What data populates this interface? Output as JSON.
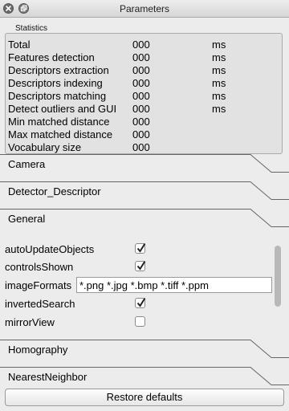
{
  "window": {
    "title": "Parameters"
  },
  "statistics": {
    "group_title": "Statistics",
    "rows": [
      {
        "name": "Total",
        "value": "000",
        "unit": "ms"
      },
      {
        "name": "Features detection",
        "value": "000",
        "unit": "ms"
      },
      {
        "name": "Descriptors extraction",
        "value": "000",
        "unit": "ms"
      },
      {
        "name": "Descriptors indexing",
        "value": "000",
        "unit": "ms"
      },
      {
        "name": "Descriptors matching",
        "value": "000",
        "unit": "ms"
      },
      {
        "name": "Detect outliers and GUI",
        "value": "000",
        "unit": "ms"
      },
      {
        "name": "Min matched distance",
        "value": "000",
        "unit": ""
      },
      {
        "name": "Max matched distance",
        "value": "000",
        "unit": ""
      },
      {
        "name": "Vocabulary size",
        "value": "000",
        "unit": ""
      }
    ]
  },
  "sections": {
    "camera": "Camera",
    "detector_descriptor": "Detector_Descriptor",
    "general": "General",
    "homography": "Homography",
    "nearest_neighbor": "NearestNeighbor"
  },
  "general": {
    "auto_update_objects": {
      "label": "autoUpdateObjects",
      "checked": true
    },
    "controls_shown": {
      "label": "controlsShown",
      "checked": true
    },
    "image_formats": {
      "label": "imageFormats",
      "value": "*.png *.jpg *.bmp *.tiff *.ppm"
    },
    "inverted_search": {
      "label": "invertedSearch",
      "checked": true
    },
    "mirror_view": {
      "label": "mirrorView",
      "checked": false
    }
  },
  "footer": {
    "restore_defaults": "Restore defaults"
  }
}
